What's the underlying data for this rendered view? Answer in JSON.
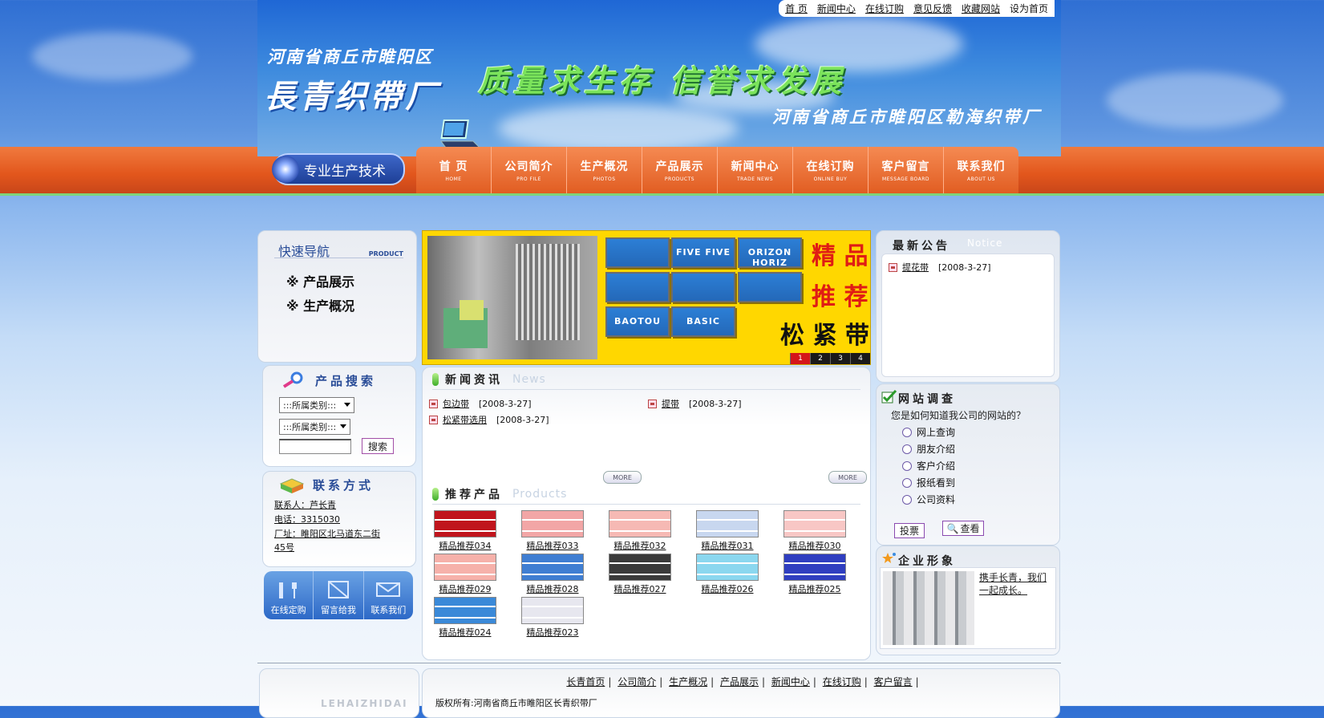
{
  "toplinks": [
    "首 页",
    "新闻中心",
    "在线订购",
    "意见反馈",
    "收藏网站",
    "设为首页"
  ],
  "header": {
    "brand_small": "河南省商丘市睢阳区",
    "brand_big": "長青织帶厂",
    "slogan": "质量求生存 信誉求发展",
    "slogan2": "河南省商丘市睢阳区勒海织带厂"
  },
  "tech_badge": "专业生产技术",
  "nav": [
    {
      "zh": "首 页",
      "en": "HOME"
    },
    {
      "zh": "公司简介",
      "en": "PRO FILE"
    },
    {
      "zh": "生产概况",
      "en": "PHOTOS"
    },
    {
      "zh": "产品展示",
      "en": "PRODUCTS"
    },
    {
      "zh": "新闻中心",
      "en": "TRADE NEWS"
    },
    {
      "zh": "在线订购",
      "en": "ONLINE BUY"
    },
    {
      "zh": "客户留言",
      "en": "MESSAGE BOARD"
    },
    {
      "zh": "联系我们",
      "en": "ABOUT US"
    }
  ],
  "quicknav": {
    "title": "快速导航",
    "title_en": "PRODUCT",
    "items": [
      "※ 产品展示",
      "※ 生产概况"
    ]
  },
  "search": {
    "title": "产品搜索",
    "select1": ":::所属类别:::",
    "select2": ":::所属类别:::",
    "button": "搜索"
  },
  "contact": {
    "title": "联系方式",
    "person": "联系人：芦长青",
    "phone": "电话：3315030",
    "address1": "厂址：睢阳区北马道东二街",
    "address2": "45号"
  },
  "quickbtns": [
    "在线定购",
    "留言给我",
    "联系我们"
  ],
  "banner": {
    "tapes": [
      "",
      "FIVE FIVE",
      "ORIZON HORIZ",
      "",
      "",
      "",
      "BAOTOU",
      "BASIC"
    ],
    "red1": "精 品",
    "red2": "推 荐",
    "black": "松 紧 带",
    "pages": [
      "1",
      "2",
      "3",
      "4"
    ],
    "active_page": "1"
  },
  "news": {
    "title": "新闻资讯",
    "title_en": "News",
    "items": [
      {
        "title": "包边带",
        "date": "[2008-3-27]"
      },
      {
        "title": "松紧带选用",
        "date": "[2008-3-27]"
      },
      {
        "title": "提带",
        "date": "[2008-3-27]"
      }
    ],
    "more": "MORE"
  },
  "products": {
    "title": "推荐产品",
    "title_en": "Products",
    "items": [
      {
        "label": "精品推荐034",
        "color": "#c0151d"
      },
      {
        "label": "精品推荐033",
        "color": "#f2a6a6"
      },
      {
        "label": "精品推荐032",
        "color": "#f6b9b4"
      },
      {
        "label": "精品推荐031",
        "color": "#c8d7ef"
      },
      {
        "label": "精品推荐030",
        "color": "#f8c7c5"
      },
      {
        "label": "精品推荐029",
        "color": "#f6b1aa"
      },
      {
        "label": "精品推荐028",
        "color": "#3f7ed2"
      },
      {
        "label": "精品推荐027",
        "color": "#3a3a3a"
      },
      {
        "label": "精品推荐026",
        "color": "#8bd7ef"
      },
      {
        "label": "精品推荐025",
        "color": "#2f3ec0"
      },
      {
        "label": "精品推荐024",
        "color": "#3a89d8"
      },
      {
        "label": "精品推荐023",
        "color": "#e7e7ef"
      }
    ]
  },
  "notice": {
    "title": "最新公告",
    "title_en": "Notice",
    "item_title": "提花带",
    "item_date": "[2008-3-27]"
  },
  "survey": {
    "title": "网站调查",
    "question": "您是如何知道我公司的网站的？",
    "options": [
      "网上查询",
      "朋友介绍",
      "客户介绍",
      "报纸看到",
      "公司资料"
    ],
    "vote": "投票",
    "view": "查看"
  },
  "image": {
    "title": "企业形象",
    "caption": "携手长青，我们一起成长。"
  },
  "footer": {
    "links": [
      "长青首页",
      "公司简介",
      "生产概况",
      "产品展示",
      "新闻中心",
      "在线订购",
      "客户留言"
    ],
    "copyright": "版权所有:河南省商丘市睢阳区长青织带厂",
    "watermark": "LEHAIZHIDAI"
  }
}
